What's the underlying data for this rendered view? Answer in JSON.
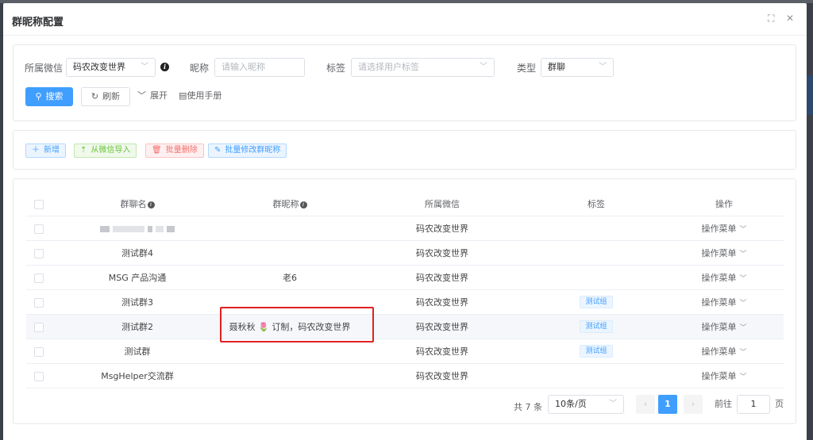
{
  "dialog": {
    "title": "群昵称配置",
    "controls": {
      "maximize": "⛶",
      "close": "✕"
    }
  },
  "search": {
    "wechat_label": "所属微信",
    "wechat_value": "码农改变世界",
    "nickname_label": "昵称",
    "nickname_placeholder": "请输入昵称",
    "tag_label": "标签",
    "tag_placeholder": "请选择用户标签",
    "type_label": "类型",
    "type_value": "群聊",
    "search_button": "搜索",
    "refresh_button": "刷新",
    "expand_button": "展开",
    "manual_button": "使用手册"
  },
  "actions": {
    "add": "新增",
    "import": "从微信导入",
    "batch_delete": "批量删除",
    "batch_edit": "批量修改群昵称"
  },
  "table": {
    "headers": {
      "group_name": "群聊名",
      "nickname": "群昵称",
      "wechat": "所属微信",
      "tag": "标签",
      "ops": "操作"
    },
    "rows": [
      {
        "group_name": "",
        "nickname": "",
        "wechat": "码农改变世界",
        "tag": "",
        "op": "操作菜单"
      },
      {
        "group_name": "测试群4",
        "nickname": "",
        "wechat": "码农改变世界",
        "tag": "",
        "op": "操作菜单"
      },
      {
        "group_name": "MSG 产品沟通",
        "nickname": "老6",
        "wechat": "码农改变世界",
        "tag": "",
        "op": "操作菜单"
      },
      {
        "group_name": "测试群3",
        "nickname": "",
        "wechat": "码农改变世界",
        "tag": "测试组",
        "op": "操作菜单"
      },
      {
        "group_name": "测试群2",
        "nickname": "聂秋秋 🌷 订制，码农改变世界",
        "wechat": "码农改变世界",
        "tag": "测试组",
        "op": "操作菜单"
      },
      {
        "group_name": "测试群",
        "nickname": "",
        "wechat": "码农改变世界",
        "tag": "测试组",
        "op": "操作菜单"
      },
      {
        "group_name": "MsgHelper交流群",
        "nickname": "",
        "wechat": "码农改变世界",
        "tag": "",
        "op": "操作菜单"
      }
    ]
  },
  "pagination": {
    "total_text": "共 7 条",
    "page_size": "10条/页",
    "current_page": "1",
    "goto_label": "前往",
    "goto_value": "1",
    "page_unit": "页"
  },
  "colors": {
    "primary": "#409eff",
    "highlight_border": "#e02020",
    "success": "#67c23a",
    "danger": "#f56c6c"
  },
  "icons": [
    "search-icon",
    "refresh-icon",
    "chevron-down-icon",
    "book-icon",
    "plus-icon",
    "upload-icon",
    "trash-icon",
    "edit-icon",
    "info-icon",
    "maximize-icon",
    "close-icon"
  ]
}
